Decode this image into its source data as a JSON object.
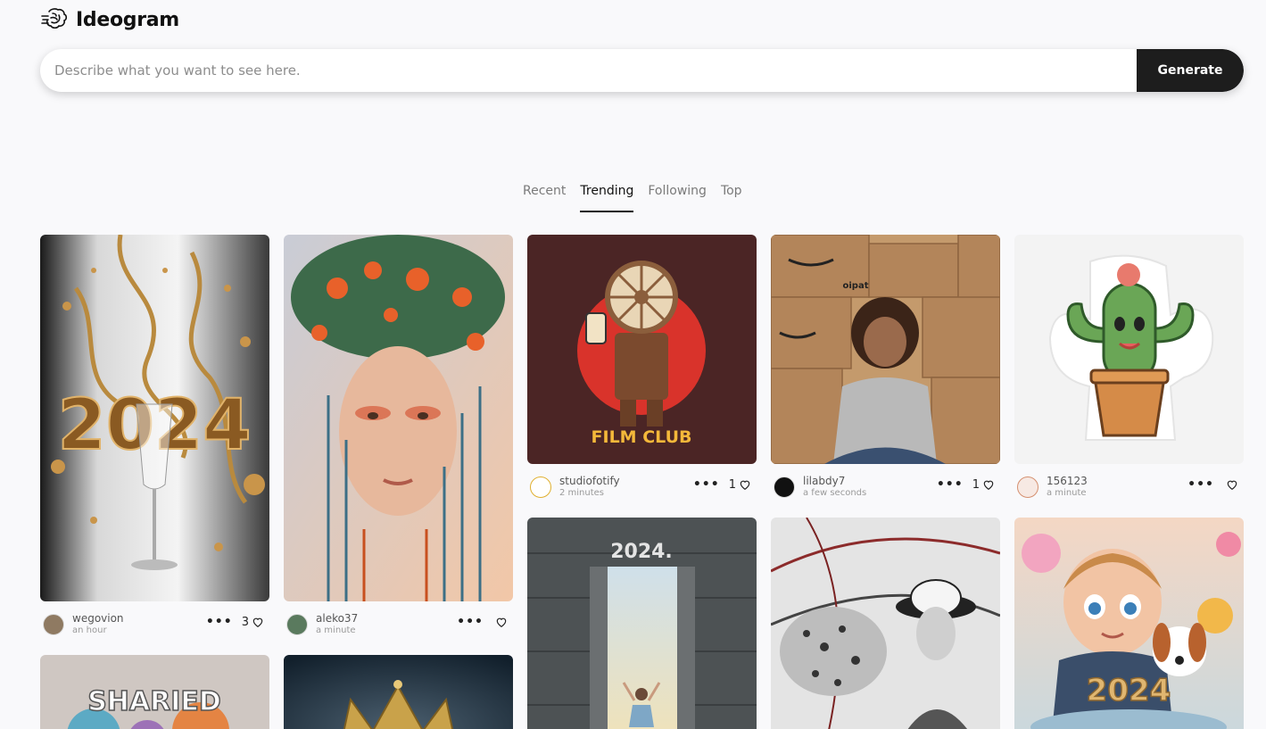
{
  "brand": {
    "name": "Ideogram"
  },
  "prompt": {
    "placeholder": "Describe what you want to see here.",
    "button": "Generate"
  },
  "tabs": [
    {
      "label": "Recent"
    },
    {
      "label": "Trending"
    },
    {
      "label": "Following"
    },
    {
      "label": "Top"
    }
  ],
  "active_tab": "Trending",
  "cards": [
    {
      "user": "wegovion",
      "time": "an hour",
      "likes": "3",
      "image_text": "2024"
    },
    {
      "user": "aleko37",
      "time": "a minute",
      "likes": ""
    },
    {
      "user": "studiofotify",
      "time": "2 minutes",
      "likes": "1",
      "image_text": "FILM CLUB"
    },
    {
      "user": "lilabdy7",
      "time": "a few seconds",
      "likes": "1",
      "image_text": "oipat"
    },
    {
      "user": "156123",
      "time": "a minute",
      "likes": ""
    },
    {
      "image_text": "SHARIED"
    },
    {},
    {
      "image_text": "2024."
    },
    {},
    {
      "image_text": "2024"
    }
  ],
  "colors": {
    "accent": "#1d1d1d",
    "background": "#f9f9fb"
  }
}
